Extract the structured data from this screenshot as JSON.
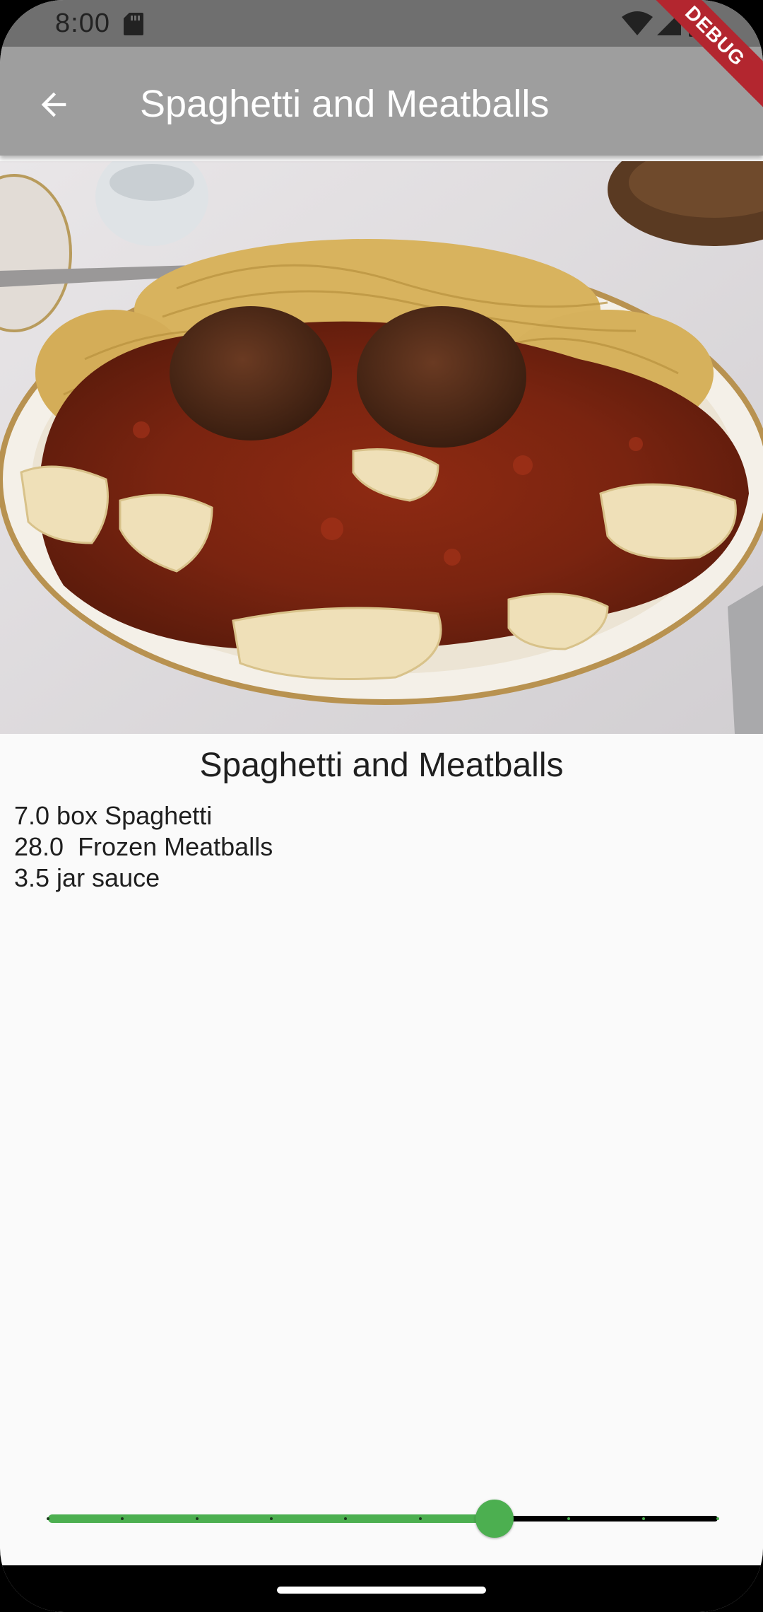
{
  "status_bar": {
    "time": "8:00",
    "icons": [
      "sd-card-icon",
      "wifi-icon",
      "signal-icon",
      "battery-icon"
    ]
  },
  "app_bar": {
    "back_icon": "arrow-back-icon",
    "title": "Spaghetti and Meatballs",
    "background": "#9e9e9e"
  },
  "debug_banner": "DEBUG",
  "photo": {
    "subject": "food-photo"
  },
  "recipe": {
    "title": "Spaghetti and Meatballs",
    "ingredients": [
      "7.0 box Spaghetti",
      "28.0  Frozen Meatballs",
      "3.5 jar sauce"
    ]
  },
  "slider": {
    "divisions": 9,
    "value_fraction": 0.667,
    "active_color": "#4caf50",
    "inactive_color": "#000000"
  }
}
